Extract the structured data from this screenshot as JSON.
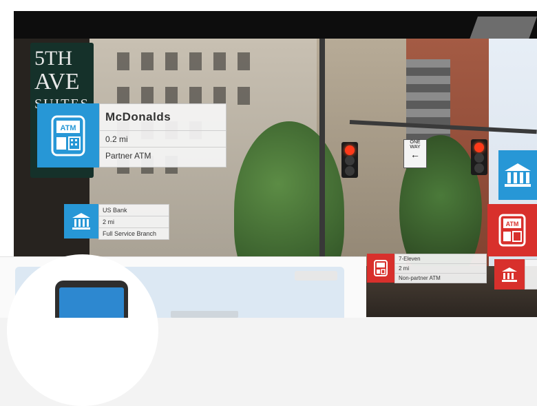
{
  "scene": {
    "sign": {
      "line1": "5TH",
      "line2": "AVE",
      "line3": "SUITES"
    },
    "street_sign": "ONE WAY"
  },
  "pois": {
    "main": {
      "icon": "atm-icon",
      "name": "McDonalds",
      "distance": "0.2 mi",
      "type": "Partner ATM"
    },
    "bank": {
      "icon": "bank-icon",
      "name": "US Bank",
      "distance": "2 mi",
      "type": "Full Service Branch"
    },
    "right_atm": {
      "icon": "atm-icon"
    },
    "right_bank_top": {
      "icon": "bank-icon"
    },
    "right_bank_bottom": {
      "icon": "bank-icon"
    },
    "small": {
      "icon": "atm-icon",
      "name": "7-Eleven",
      "distance": "2 mi",
      "type": "Non-partner ATM"
    }
  },
  "colors": {
    "atm_blue": "#2797d6",
    "alert_red": "#d8302c",
    "topbar": "#0d0d0d"
  }
}
